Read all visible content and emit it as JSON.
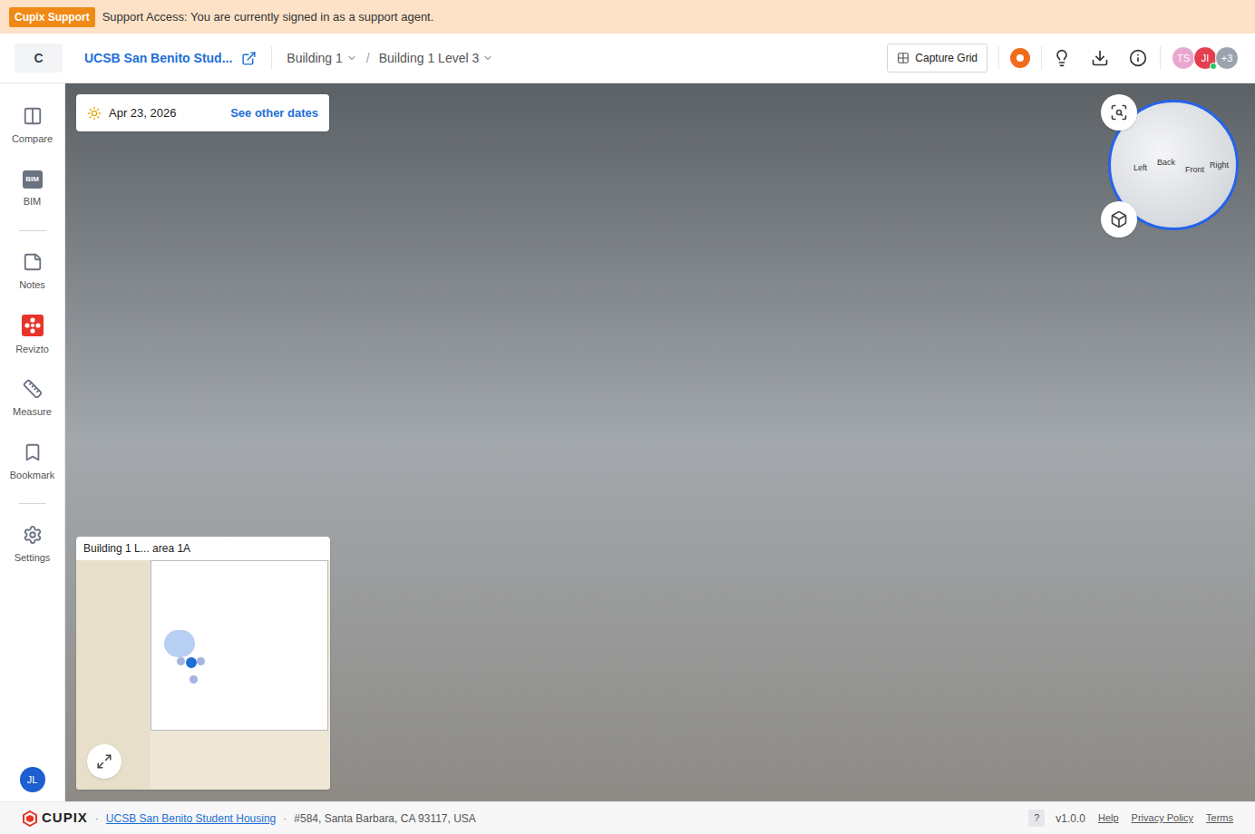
{
  "banner": {
    "badge": "Cupix Support",
    "message": "Support Access: You are currently signed in as a support agent."
  },
  "header": {
    "logo": "C",
    "project": "UCSB San Benito Stud...",
    "breadcrumbs": [
      {
        "label": "Building 1",
        "separator": "/"
      },
      {
        "label": "Building 1 Level 3",
        "separator": ""
      }
    ],
    "capture_button": "Capture Grid",
    "avatars": [
      {
        "initials": "TS",
        "color": "#e9a6cf",
        "online": false
      },
      {
        "initials": "JI",
        "color": "#e2404f",
        "online": true
      },
      {
        "initials": "+3",
        "color": "#9ca3af",
        "online": false
      }
    ]
  },
  "sidebar": {
    "groups": [
      [
        {
          "label": "Compare",
          "icon": "compare",
          "badge": ""
        },
        {
          "label": "BIM",
          "icon": "bim",
          "badge": "BIM"
        }
      ],
      [
        {
          "label": "Notes",
          "icon": "notes",
          "badge": ""
        },
        {
          "label": "Revizto",
          "icon": "revizto",
          "badge": ""
        },
        {
          "label": "Measure",
          "icon": "measure",
          "badge": ""
        },
        {
          "label": "Bookmark",
          "icon": "bookmark",
          "badge": ""
        }
      ],
      [
        {
          "label": "Settings",
          "icon": "settings",
          "badge": ""
        }
      ]
    ],
    "user": "JL"
  },
  "viewer": {
    "date": "Apr 23, 2026",
    "other_dates": "See other dates",
    "compass": {
      "labels": [
        "Left",
        "Back",
        "Front",
        "Right"
      ]
    },
    "minimap": {
      "title": "Building 1 L... area 1A"
    }
  },
  "footer": {
    "logo": "CUPIX",
    "separator": "·",
    "project_link": "UCSB San Benito Student Housing",
    "address": "#584, Santa Barbara, CA 93117, USA",
    "help_key": "?",
    "version": "v1.0.0",
    "links": [
      "Help",
      "Privacy Policy",
      "Terms"
    ]
  }
}
